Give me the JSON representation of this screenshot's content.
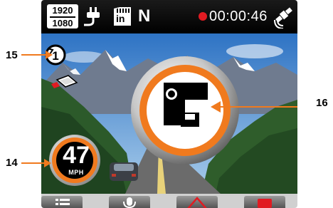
{
  "status_bar": {
    "resolution_top": "1920",
    "resolution_bottom": "1080",
    "sd_card_label": "in",
    "gear": "N",
    "recording_time": "00:00:46",
    "icons": [
      "power-plug-icon",
      "sd-card-icon",
      "record-dot-icon",
      "gps-satellite-icon"
    ],
    "record_color": "#e11b22"
  },
  "overlay": {
    "lane_icon": "lane-departure-icon",
    "rotation_icon": "rotation-counter-icon",
    "rotation_number": "1",
    "camera_warning_icon": "speed-camera-warning-icon",
    "accent_color": "#f07a1e"
  },
  "speedometer": {
    "value": "47",
    "unit": "MPH"
  },
  "callouts": {
    "c14": "14",
    "c15": "15",
    "c16": "16"
  },
  "bottom_buttons": [
    {
      "name": "menu-button",
      "icon": "list-icon"
    },
    {
      "name": "microphone-button",
      "icon": "microphone-icon"
    },
    {
      "name": "warning-button",
      "icon": "warning-triangle-icon"
    },
    {
      "name": "record-button",
      "icon": "record-square-icon"
    }
  ]
}
